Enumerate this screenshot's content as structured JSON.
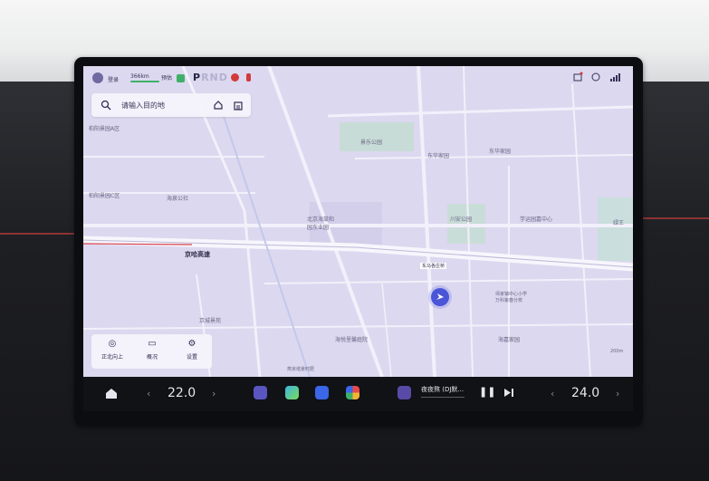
{
  "status": {
    "user": "登录",
    "range": "366km",
    "range_sub": "预估",
    "gear_active": "P",
    "gear_rest": "RND"
  },
  "search": {
    "placeholder": "请输入目的地"
  },
  "map": {
    "places": {
      "a1": "柏阳景园A区",
      "c": "柏阳景园C区",
      "haiquan": "海泉公社",
      "park1": "景乐公园",
      "donghua": "东华家园",
      "donghua2": "东华家园",
      "haitang": "北京海棠和\n园东业园",
      "chuanan": "川安公园",
      "xuezhi": "学运园嘉中心",
      "jingcheng": "京城景苑",
      "haiyue": "海悦里馨庭院",
      "haijiayuan": "海嘉家园",
      "school": "师家镇中心小学\n万科紫春分校",
      "bottom": "燕京塔景时居",
      "right_edge": "绿王"
    },
    "roads": {
      "expressway": "京哈高速",
      "dongma": "东马各庄桥"
    },
    "scale": "200m"
  },
  "controls": [
    {
      "label": "正北向上",
      "icon": "compass-icon"
    },
    {
      "label": "概况",
      "icon": "overview-icon"
    },
    {
      "label": "设置",
      "icon": "settings-icon"
    }
  ],
  "dock": {
    "temp_left": "22.0",
    "temp_right": "24.0",
    "song": "夜夜熬 (DJ默..."
  },
  "colors": {
    "map_bg": "#dcd8ef",
    "accent": "#4a55d8",
    "road": "#f4f2fb",
    "green_area": "#c9ddd8"
  }
}
